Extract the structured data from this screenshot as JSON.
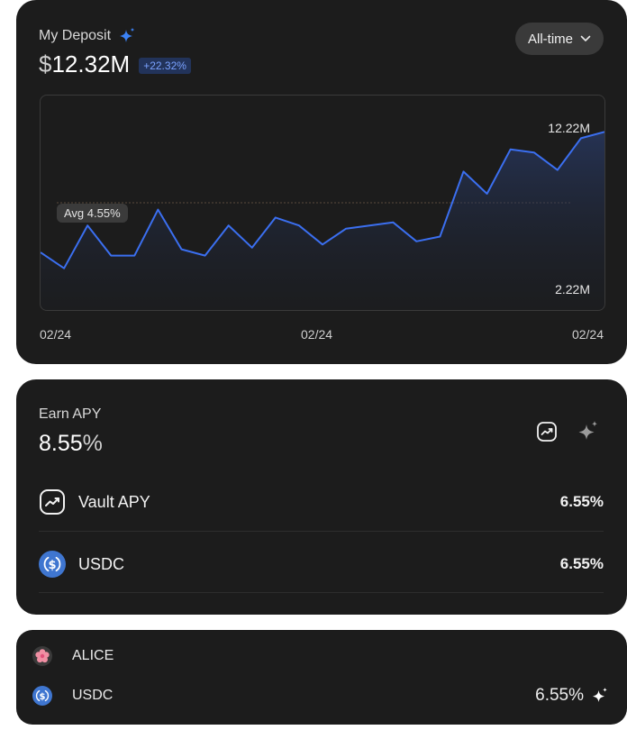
{
  "deposit": {
    "title": "My Deposit",
    "currency_symbol": "$",
    "amount": "12.32M",
    "change_badge": "+22.32%",
    "range_button": "All-time",
    "sparkle_color": "#3b82f6",
    "badge_color": "#7aa2ff"
  },
  "chart_data": {
    "type": "area",
    "y_labels": {
      "top": "12.22M",
      "bottom": "2.22M"
    },
    "average_label": "Avg 4.55%",
    "x_ticks": [
      "02/24",
      "02/24",
      "02/24"
    ],
    "values": [
      4.6,
      3.6,
      6.3,
      4.4,
      4.4,
      7.3,
      4.8,
      4.4,
      6.3,
      4.9,
      6.8,
      6.3,
      5.1,
      6.1,
      6.3,
      6.5,
      5.3,
      5.6,
      9.7,
      8.3,
      11.1,
      10.9,
      9.8,
      11.8,
      12.2
    ],
    "series_color": "#3b6ff0"
  },
  "earn": {
    "title": "Earn APY",
    "value": "8.55",
    "unit": "%",
    "rows": [
      {
        "label": "Vault APY",
        "value": "6.55%",
        "icon": "trend-up-icon"
      },
      {
        "label": "USDC",
        "value": "6.55%",
        "icon": "usdc-icon"
      }
    ]
  },
  "holdings": {
    "rows": [
      {
        "label": "ALICE",
        "value": "",
        "icon": "alice-token-icon"
      },
      {
        "label": "USDC",
        "value": "6.55%",
        "icon": "usdc-icon"
      }
    ]
  },
  "colors": {
    "card_bg": "#1c1c1c",
    "usdc_blue": "#3f76d0",
    "alice_pink": "#f08fa3"
  }
}
